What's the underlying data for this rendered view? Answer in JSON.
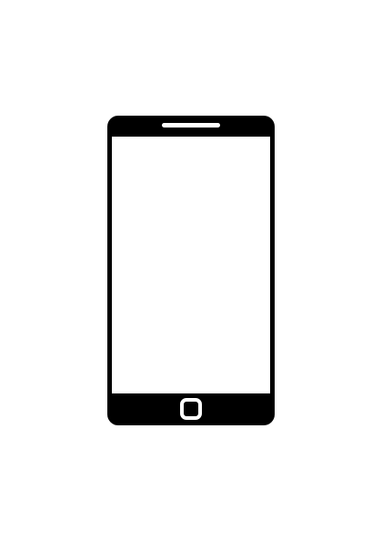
{
  "device": {
    "type": "smartphone",
    "body_color": "#000000",
    "screen_color": "#ffffff",
    "detail_color": "#ffffff",
    "icons": [
      "speaker-grille-icon",
      "home-button-icon"
    ]
  }
}
